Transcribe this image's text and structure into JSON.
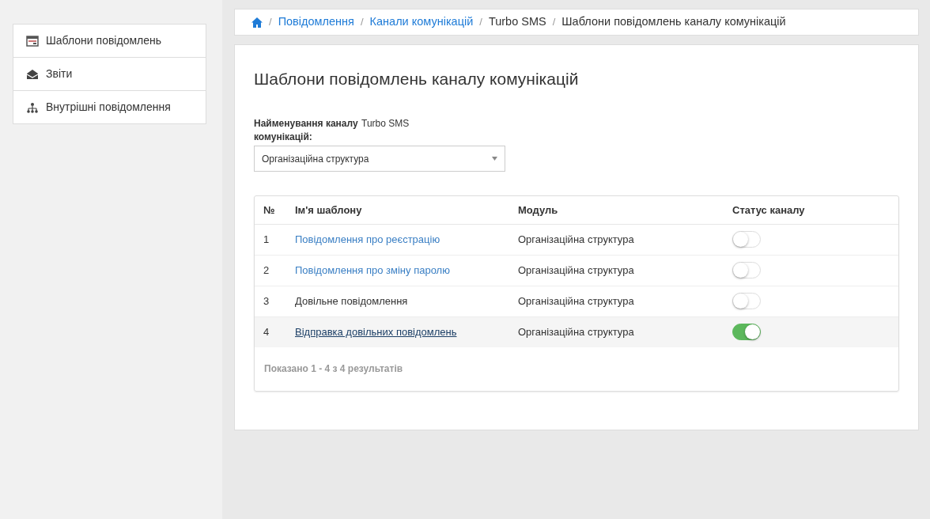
{
  "sidebar": {
    "items": [
      {
        "label": "Шаблони повідомлень"
      },
      {
        "label": "Звіти"
      },
      {
        "label": "Внутрішні повідомлення"
      }
    ]
  },
  "breadcrumb": [
    {
      "separator": "/",
      "label": "Повідомлення",
      "link": true
    },
    {
      "separator": "/",
      "label": "Канали комунікацій",
      "link": true
    },
    {
      "separator": "/",
      "label": "Turbo SMS",
      "link": false
    },
    {
      "separator": "/",
      "label": "Шаблони повідомлень каналу комунікацій",
      "link": false
    }
  ],
  "page_title": "Шаблони повідомлень каналу комунікацій",
  "channel": {
    "label": "Найменування каналу комунікацій:",
    "value": "Turbo SMS"
  },
  "module_select": {
    "value": "Організаційна структура"
  },
  "table": {
    "columns": [
      "№",
      "Ім'я шаблону",
      "Модуль",
      "Статус каналу"
    ],
    "rows": [
      {
        "number": "1",
        "name": "Повідомлення про реєстрацію",
        "link": true,
        "hovered": false,
        "module": "Організаційна структура",
        "on": false
      },
      {
        "number": "2",
        "name": "Повідомлення про зміну паролю",
        "link": true,
        "hovered": false,
        "module": "Організаційна структура",
        "on": false
      },
      {
        "number": "3",
        "name": "Довільне повідомлення",
        "link": false,
        "hovered": false,
        "module": "Організаційна структура",
        "on": false
      },
      {
        "number": "4",
        "name": "Відправка довільних повідомлень",
        "link": true,
        "hovered": true,
        "module": "Організаційна структура",
        "on": true
      }
    ],
    "summary": "Показано 1 - 4 з 4 результатів"
  }
}
